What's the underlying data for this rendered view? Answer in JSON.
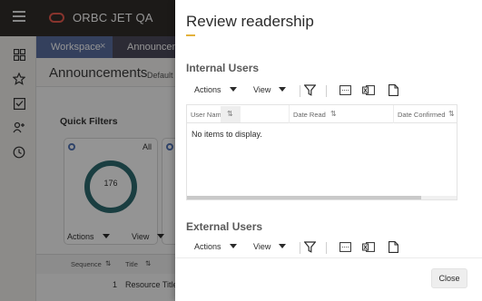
{
  "app": {
    "title": "ORBC JET QA"
  },
  "tabs": {
    "workspace": "Workspace",
    "close_glyph": "×",
    "announcements": "Announceme"
  },
  "page": {
    "title": "Announcements",
    "default_label": "Default"
  },
  "quick_filters": {
    "label": "Quick Filters",
    "all_label": "All",
    "count": "176"
  },
  "bg_toolbar": {
    "actions": "Actions",
    "view": "View"
  },
  "bg_table": {
    "col_sequence": "Sequence",
    "col_title": "Title",
    "row_value": "1",
    "row_title": "Resource Title"
  },
  "drawer": {
    "title": "Review readership",
    "close_label": "Close",
    "internal": {
      "title": "Internal Users",
      "actions": "Actions",
      "view": "View",
      "columns": [
        "User Name",
        "Date Read",
        "Date Confirmed"
      ],
      "empty_text": "No items to display."
    },
    "external": {
      "title": "External Users",
      "actions": "Actions",
      "view": "View"
    }
  },
  "colors": {
    "topbar": "#312d2a",
    "accent": "#e3b23c",
    "logo": "#e85a4f",
    "tab_active": "#5b6fa0",
    "donut": "#2e6b71"
  },
  "icons": [
    "hamburger-icon",
    "oracle-logo-icon",
    "grid-icon",
    "star-icon",
    "checklist-icon",
    "people-icon",
    "clock-icon",
    "filter-icon",
    "freeze-icon",
    "excel-icon",
    "document-icon",
    "sort-icon"
  ]
}
